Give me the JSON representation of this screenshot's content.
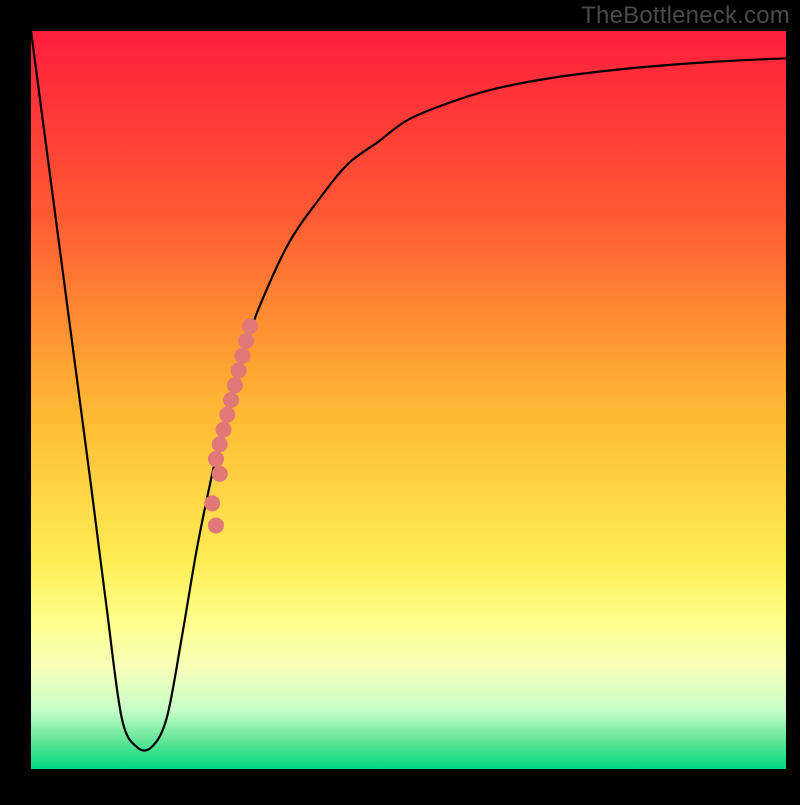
{
  "watermark": "TheBottleneck.com",
  "chart_data": {
    "type": "line",
    "title": "",
    "xlabel": "",
    "ylabel": "",
    "xlim": [
      0,
      100
    ],
    "ylim": [
      0,
      100
    ],
    "series": [
      {
        "name": "bottleneck-curve",
        "x": [
          0,
          4,
          8,
          10,
          12,
          14,
          16,
          18,
          20,
          22,
          24,
          26,
          28,
          30,
          34,
          38,
          42,
          46,
          50,
          56,
          62,
          70,
          80,
          90,
          100
        ],
        "y": [
          100,
          69,
          38,
          22,
          7,
          3,
          3,
          7,
          18,
          30,
          40,
          49,
          56,
          62,
          71,
          77,
          82,
          85,
          88,
          90.5,
          92.3,
          93.8,
          95,
          95.8,
          96.3
        ]
      }
    ],
    "points": {
      "name": "highlight-points",
      "x": [
        24.5,
        25.0,
        25.5,
        26.0,
        26.5,
        27.0,
        27.5,
        28.0,
        28.5,
        29.0,
        25.0,
        24.0,
        24.5
      ],
      "y": [
        42,
        44,
        46,
        48,
        50,
        52,
        54,
        56,
        58,
        60,
        40,
        36,
        33
      ],
      "color": "#e07878",
      "radius": 8
    },
    "background_gradient": {
      "stops": [
        {
          "offset": 0.0,
          "color": "#ff1e3c"
        },
        {
          "offset": 0.25,
          "color": "#ff5a33"
        },
        {
          "offset": 0.5,
          "color": "#ffb433"
        },
        {
          "offset": 0.72,
          "color": "#ffed55"
        },
        {
          "offset": 0.8,
          "color": "#ffff8c"
        },
        {
          "offset": 0.86,
          "color": "#f8ffb8"
        },
        {
          "offset": 0.92,
          "color": "#c8ffc8"
        },
        {
          "offset": 0.96,
          "color": "#66e699"
        },
        {
          "offset": 1.0,
          "color": "#00d880"
        }
      ]
    },
    "frame": {
      "margin_left": 31,
      "margin_right": 14,
      "margin_top": 31,
      "margin_bottom": 31,
      "stroke": "#000000",
      "stroke_width": 28
    }
  }
}
